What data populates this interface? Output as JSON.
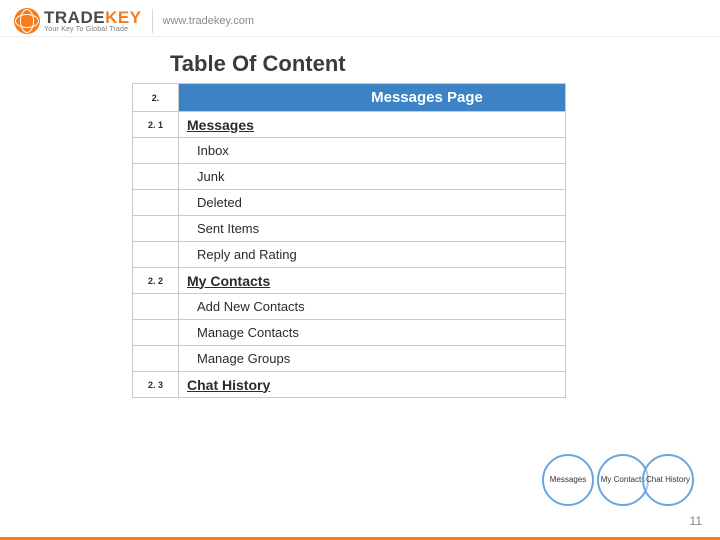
{
  "header": {
    "brand_word1": "TRADE",
    "brand_word2": "KEY",
    "brand_tagline": "Your Key To Global Trade",
    "site_url": "www.tradekey.com"
  },
  "toc": {
    "title": "Table Of Content",
    "header_num": "2.",
    "header_title": "Messages Page",
    "sections": [
      {
        "num": "2. 1",
        "title": "Messages",
        "items": [
          "Inbox",
          "Junk",
          "Deleted",
          "Sent Items",
          "Reply and Rating"
        ]
      },
      {
        "num": "2. 2",
        "title": "My Contacts",
        "items": [
          "Add New Contacts",
          "Manage Contacts",
          "Manage Groups"
        ]
      },
      {
        "num": "2. 3",
        "title": "Chat History",
        "items": []
      }
    ]
  },
  "circles": {
    "c1": "Messages",
    "c2": "My Contacts",
    "c3": "Chat History"
  },
  "page_number": "11"
}
